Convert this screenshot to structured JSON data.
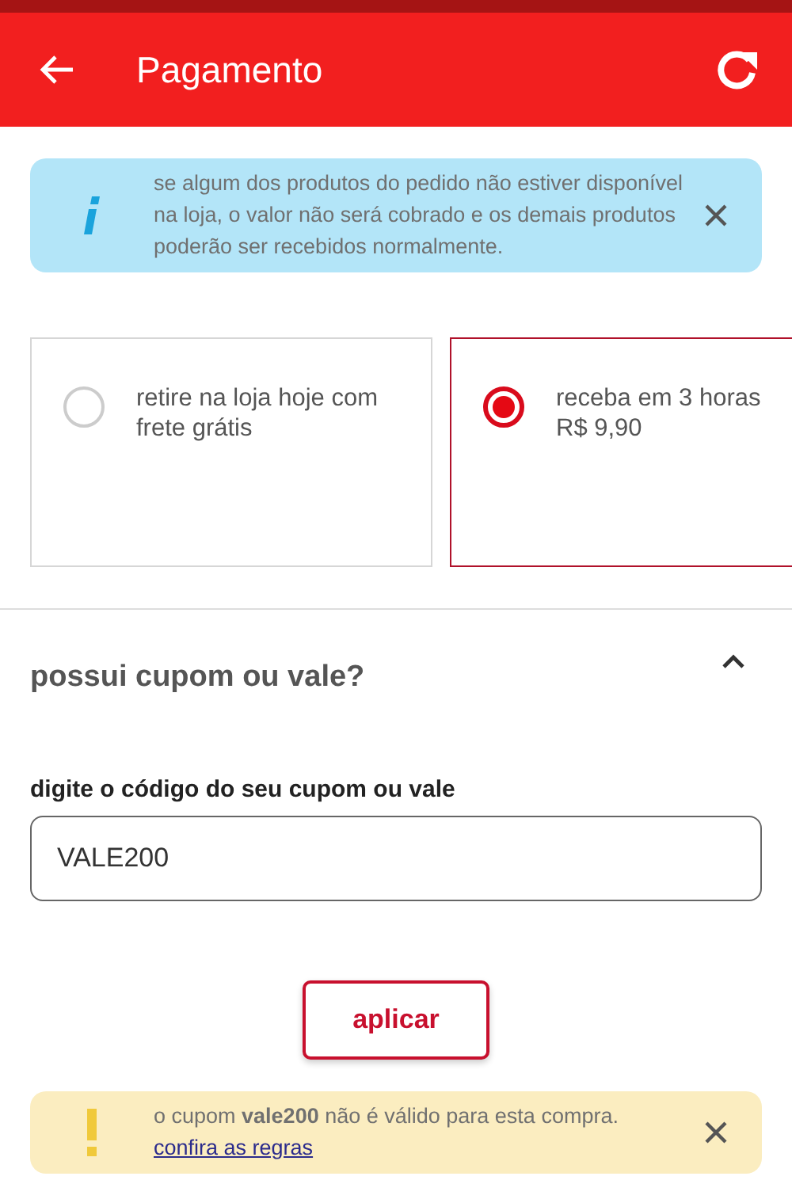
{
  "header": {
    "title": "Pagamento"
  },
  "info_banner": {
    "text": "se algum dos produtos do pedido não estiver disponível na loja, o valor não será cobrado e os demais produtos poderão ser recebidos normalmente."
  },
  "delivery_options": [
    {
      "lines": [
        "retire na loja hoje com",
        "frete grátis"
      ],
      "selected": false
    },
    {
      "lines": [
        "receba em 3 horas",
        "R$ 9,90"
      ],
      "selected": true
    }
  ],
  "coupon": {
    "title": "possui cupom ou vale?",
    "expanded": true,
    "field_label": "digite o código do seu cupom ou vale",
    "value": "VALE200",
    "button": "aplicar"
  },
  "warning_banner": {
    "text": "o cupom **vale200** não é válido para esta compra.",
    "link": "confira as regras"
  }
}
